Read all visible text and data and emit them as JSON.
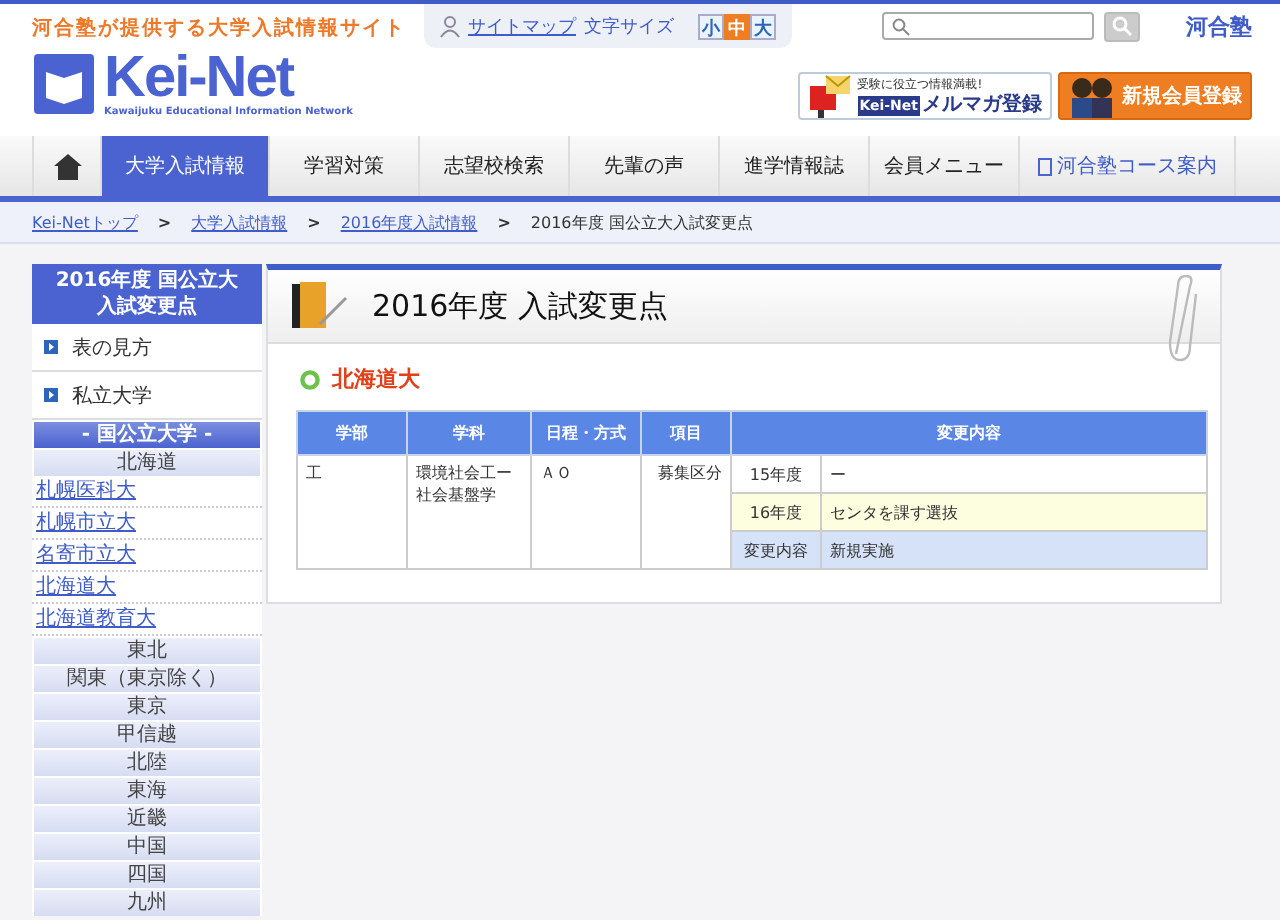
{
  "header": {
    "tagline": "河合塾が提供する大学入試情報サイト",
    "logo": "Kei-Net",
    "logo_subtitle": "Kawaijuku Educational Information Network",
    "sitemap": "サイトマップ",
    "font_size_label": "文字サイズ",
    "font_sizes": [
      {
        "label": "小",
        "selected": false
      },
      {
        "label": "中",
        "selected": true
      },
      {
        "label": "大",
        "selected": false
      }
    ],
    "brand": "河合塾",
    "banners": [
      {
        "kind": "mail",
        "caption": "受験に役立つ情報満載!",
        "badge": "Kei-Net",
        "label": "メルマガ登録"
      },
      {
        "kind": "member",
        "label": "新規会員登録"
      }
    ]
  },
  "nav": [
    {
      "kind": "home",
      "selected": false
    },
    {
      "label": "大学入試情報",
      "selected": true
    },
    {
      "label": "学習対策",
      "selected": false
    },
    {
      "label": "志望校検索",
      "selected": false
    },
    {
      "label": "先輩の声",
      "selected": false
    },
    {
      "label": "進学情報誌",
      "selected": false
    },
    {
      "label": "会員メニュー",
      "selected": false
    },
    {
      "label": "河合塾コース案内",
      "selected": false,
      "kind": "external"
    }
  ],
  "breadcrumb": [
    {
      "kind": "link",
      "label": "Kei-Netトップ"
    },
    {
      "kind": "separator",
      "label": ">"
    },
    {
      "kind": "link",
      "label": "大学入試情報"
    },
    {
      "kind": "separator",
      "label": ">"
    },
    {
      "kind": "link",
      "label": "2016年度入試情報"
    },
    {
      "kind": "separator",
      "label": ">"
    },
    {
      "kind": "current",
      "label": "2016年度 国公立大入試変更点"
    }
  ],
  "sidebar": {
    "title_lines": [
      "2016年度 国公立大",
      "入試変更点"
    ],
    "items": [
      {
        "kind": "arrow",
        "label": "表の見方"
      },
      {
        "kind": "arrow",
        "label": "私立大学"
      },
      {
        "kind": "section",
        "label": "- 国公立大学 -"
      },
      {
        "kind": "region",
        "label": "北海道"
      },
      {
        "kind": "link",
        "label": "札幌医科大"
      },
      {
        "kind": "link",
        "label": "札幌市立大"
      },
      {
        "kind": "link",
        "label": "名寄市立大"
      },
      {
        "kind": "link",
        "label": "北海道大"
      },
      {
        "kind": "link",
        "label": "北海道教育大"
      },
      {
        "kind": "region",
        "label": "東北"
      },
      {
        "kind": "region",
        "label": "関東（東京除く）"
      },
      {
        "kind": "region",
        "label": "東京"
      },
      {
        "kind": "region",
        "label": "甲信越"
      },
      {
        "kind": "region",
        "label": "北陸"
      },
      {
        "kind": "region",
        "label": "東海"
      },
      {
        "kind": "region",
        "label": "近畿"
      },
      {
        "kind": "region",
        "label": "中国"
      },
      {
        "kind": "region",
        "label": "四国"
      },
      {
        "kind": "region",
        "label": "九州"
      }
    ]
  },
  "main": {
    "title": "2016年度 入試変更点",
    "university": "北海道大",
    "table": {
      "columns": [
        "学部",
        "学科",
        "日程・方式",
        "項目",
        "変更内容"
      ],
      "rows": [
        {
          "faculty": "工",
          "department": "環境社会工ー社会基盤学",
          "schedule": "ＡＯ",
          "item": "募集区分",
          "changes": [
            {
              "kind": "plain",
              "year": "15年度",
              "content": "ー"
            },
            {
              "kind": "new",
              "year": "16年度",
              "content": "センタを課す選抜"
            },
            {
              "kind": "summary",
              "year": "変更内容",
              "content": "新規実施"
            }
          ]
        }
      ]
    }
  }
}
